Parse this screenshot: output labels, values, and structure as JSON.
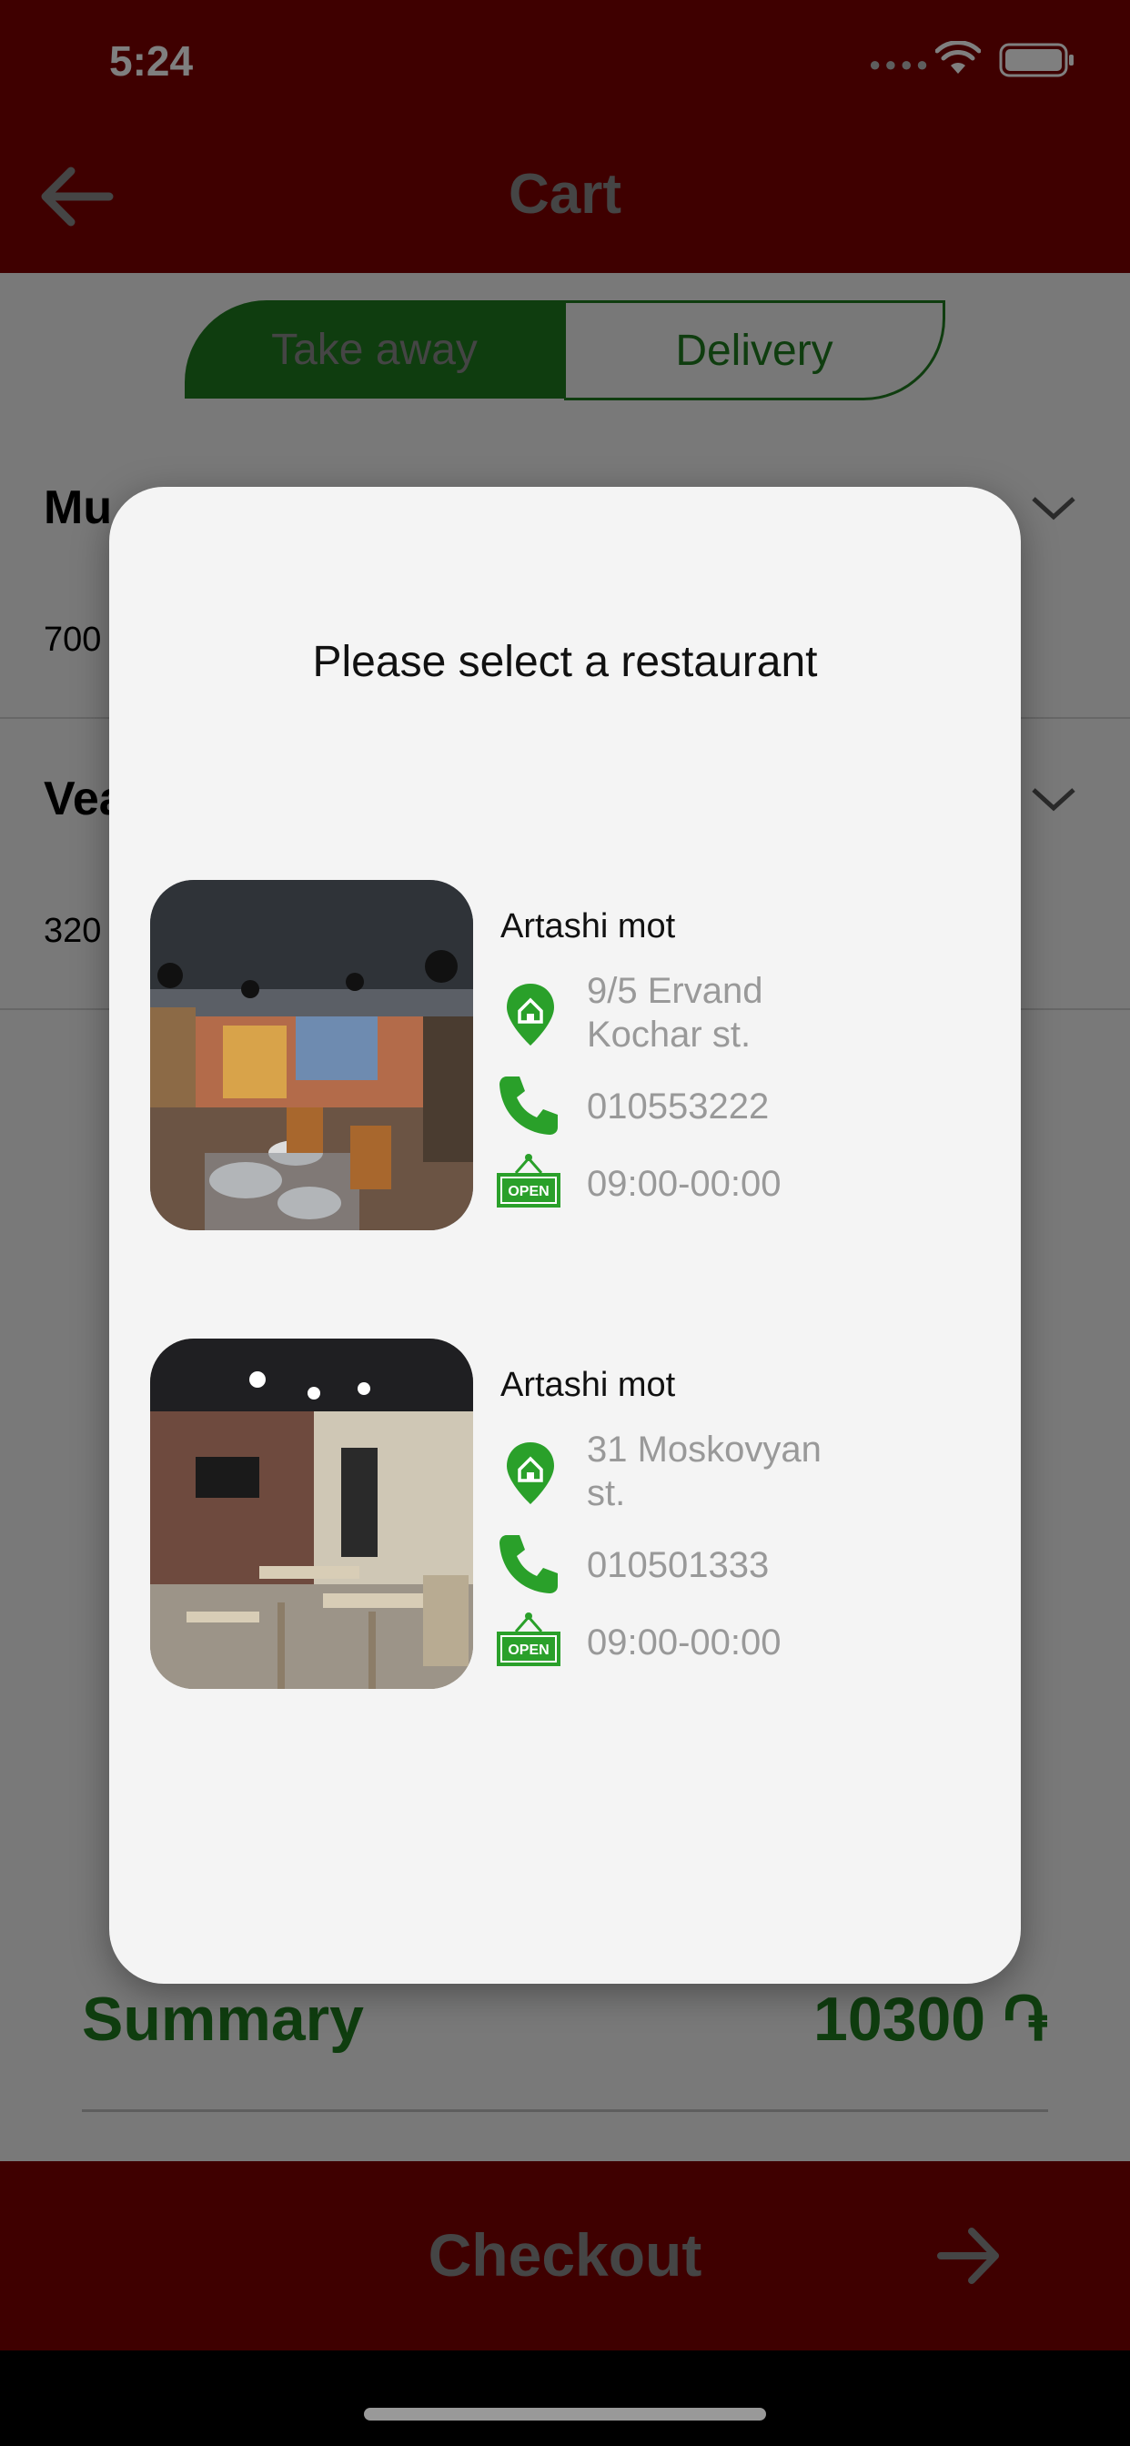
{
  "status_bar": {
    "time": "5:24"
  },
  "header": {
    "title": "Cart"
  },
  "order_type_tabs": [
    {
      "label": "Take away",
      "selected": true
    },
    {
      "label": "Delivery",
      "selected": false
    }
  ],
  "background_items": [
    {
      "title_partial": "Mu",
      "price_partial": "700"
    },
    {
      "title_partial": "Vea",
      "price_partial": "320"
    }
  ],
  "summary": {
    "label": "Summary",
    "value": "10300 ֏"
  },
  "checkout": {
    "label": "Checkout"
  },
  "modal": {
    "title": "Please select a restaurant",
    "restaurants": [
      {
        "name": "Artashi mot",
        "address_line1": "9/5 Ervand",
        "address_line2": "Kochar st.",
        "phone": "010553222",
        "hours": "09:00-00:00"
      },
      {
        "name": "Artashi mot",
        "address_line1": "31 Moskovyan",
        "address_line2": "st.",
        "phone": "010501333",
        "hours": "09:00-00:00"
      }
    ]
  },
  "colors": {
    "header_red": "#7f0000",
    "accent_green": "#1e7a1e",
    "icon_green": "#2aa02a",
    "muted_text": "#999999"
  },
  "icons": [
    "back-arrow-icon",
    "wifi-icon",
    "battery-icon",
    "chevron-down-icon",
    "location-home-icon",
    "phone-icon",
    "open-sign-icon",
    "arrow-right-icon"
  ]
}
